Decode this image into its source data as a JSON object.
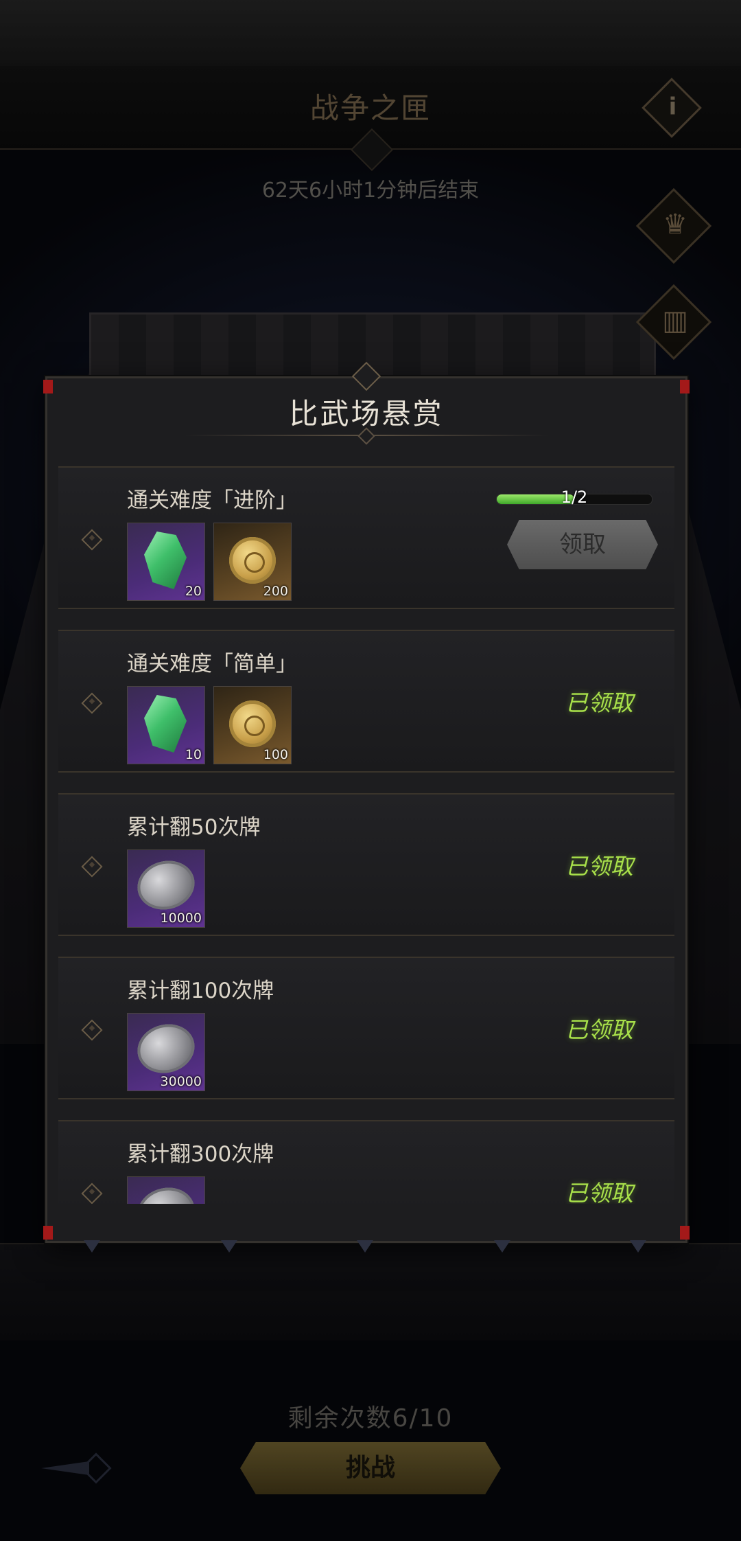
{
  "header": {
    "title": "战争之匣",
    "info_label": "i",
    "countdown": "62天6小时1分钟后结束"
  },
  "side_icons": {
    "trophy": "trophy-icon",
    "banner": "banner-icon"
  },
  "modal": {
    "title": "比武场悬赏",
    "rows": [
      {
        "title": "通关难度「进阶」",
        "items": [
          {
            "icon": "green-gem-icon",
            "count": "20"
          },
          {
            "icon": "gold-coin-icon",
            "count": "200"
          }
        ],
        "progress_text": "1/2",
        "progress_value": 0.5,
        "action_label": "领取"
      },
      {
        "title": "通关难度「简单」",
        "items": [
          {
            "icon": "green-gem-icon",
            "count": "10"
          },
          {
            "icon": "gold-coin-icon",
            "count": "100"
          }
        ],
        "status": "已领取"
      },
      {
        "title": "累计翻50次牌",
        "items": [
          {
            "icon": "silver-coin-icon",
            "count": "10000"
          }
        ],
        "status": "已领取"
      },
      {
        "title": "累计翻100次牌",
        "items": [
          {
            "icon": "silver-coin-icon",
            "count": "30000"
          }
        ],
        "status": "已领取"
      },
      {
        "title": "累计翻300次牌",
        "items": [
          {
            "icon": "silver-coin-icon",
            "count": ""
          }
        ],
        "status": "已领取"
      }
    ]
  },
  "footer": {
    "remaining": "剩余次数6/10",
    "challenge_label": "挑战",
    "back_icon": "back-arrow-icon"
  },
  "colors": {
    "claimed_green": "#a8e04a",
    "accent_gold": "#7b6a34",
    "alert_red": "#a31919"
  }
}
